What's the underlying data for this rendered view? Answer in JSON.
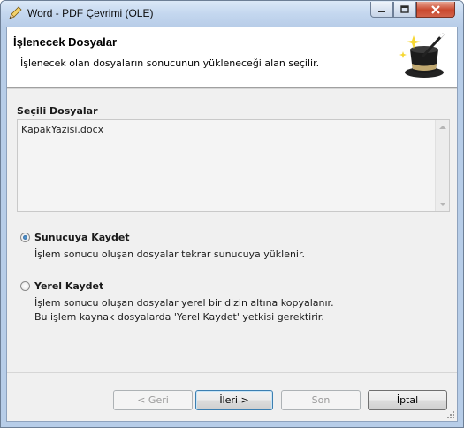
{
  "window": {
    "title": "Word - PDF Çevrimi (OLE)"
  },
  "header": {
    "title": "İşlenecek Dosyalar",
    "subtitle": "İşlenecek olan dosyaların sonucunun yükleneceği alan seçilir.",
    "logo_icon": "magic-hat-icon"
  },
  "files": {
    "label": "Seçili Dosyalar",
    "items": [
      "KapakYazisi.docx"
    ]
  },
  "options": {
    "server": {
      "label": "Sunucuya Kaydet",
      "description": "İşlem sonucu oluşan dosyalar tekrar sunucuya yüklenir.",
      "checked": true
    },
    "local": {
      "label": "Yerel Kaydet",
      "description_line1": "İşlem sonucu oluşan dosyalar yerel bir dizin altına kopyalanır.",
      "description_line2": "Bu işlem kaynak dosyalarda 'Yerel Kaydet' yetkisi gerektirir.",
      "checked": false
    }
  },
  "buttons": {
    "back": "< Geri",
    "next": "İleri >",
    "finish": "Son",
    "cancel": "İptal"
  },
  "colors": {
    "accent": "#3c7fb1",
    "title_bar": "#c4d7ef"
  }
}
